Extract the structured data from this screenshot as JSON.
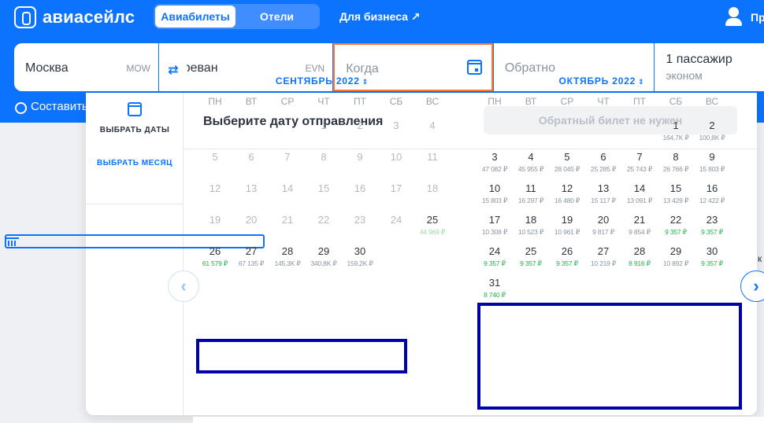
{
  "brand": {
    "name": "авиасейлс"
  },
  "nav": {
    "tab_flights": "Авиабилеты",
    "tab_hotels": "Отели",
    "business": "Для бизнеса ↗",
    "profile": "Пр"
  },
  "search": {
    "from_city": "Москва",
    "from_code": "MOW",
    "to_city": "Ереван",
    "to_code": "EVN",
    "swap_label": "⇄",
    "when_placeholder": "Когда",
    "return_placeholder": "Обратно",
    "passengers": "1 пассажир",
    "class": "эконом"
  },
  "compose_route": "Составить",
  "calendar": {
    "side_select_dates": "ВЫБРАТЬ ДАТЫ",
    "side_select_month": "ВЫБРАТЬ МЕСЯЦ",
    "title": "Выберите дату отправления",
    "no_return": "Обратный билет не нужен",
    "weekdays": [
      "ПН",
      "ВТ",
      "СР",
      "ЧТ",
      "ПТ",
      "СБ",
      "ВС"
    ],
    "months": [
      {
        "title": "СЕНТЯБРЬ 2022",
        "title_arrow": "⇕",
        "offset": 3,
        "days": [
          {
            "d": "1",
            "p": "",
            "s": "off"
          },
          {
            "d": "2",
            "p": "",
            "s": "off"
          },
          {
            "d": "3",
            "p": "",
            "s": "off"
          },
          {
            "d": "4",
            "p": "",
            "s": "off"
          },
          {
            "d": "5",
            "p": "",
            "s": "off"
          },
          {
            "d": "6",
            "p": "",
            "s": "off"
          },
          {
            "d": "7",
            "p": "",
            "s": "off"
          },
          {
            "d": "8",
            "p": "",
            "s": "off"
          },
          {
            "d": "9",
            "p": "",
            "s": "off"
          },
          {
            "d": "10",
            "p": "",
            "s": "off"
          },
          {
            "d": "11",
            "p": "",
            "s": "off"
          },
          {
            "d": "12",
            "p": "",
            "s": "off"
          },
          {
            "d": "13",
            "p": "",
            "s": "off"
          },
          {
            "d": "14",
            "p": "",
            "s": "off"
          },
          {
            "d": "15",
            "p": "",
            "s": "off"
          },
          {
            "d": "16",
            "p": "",
            "s": "off"
          },
          {
            "d": "17",
            "p": "",
            "s": "off"
          },
          {
            "d": "18",
            "p": "",
            "s": "off"
          },
          {
            "d": "19",
            "p": "",
            "s": "off"
          },
          {
            "d": "20",
            "p": "",
            "s": "off"
          },
          {
            "d": "21",
            "p": "",
            "s": "off"
          },
          {
            "d": "22",
            "p": "",
            "s": "off"
          },
          {
            "d": "23",
            "p": "",
            "s": "off"
          },
          {
            "d": "24",
            "p": "",
            "s": "off"
          },
          {
            "d": "25",
            "p": "44 969 ₽",
            "s": "lightcheap"
          },
          {
            "d": "26",
            "p": "61 579 ₽",
            "s": "cheap"
          },
          {
            "d": "27",
            "p": "67 135 ₽",
            "s": "on"
          },
          {
            "d": "28",
            "p": "145,3K ₽",
            "s": "on"
          },
          {
            "d": "29",
            "p": "340,8K ₽",
            "s": "on"
          },
          {
            "d": "30",
            "p": "159,2K ₽",
            "s": "on"
          }
        ]
      },
      {
        "title": "ОКТЯБРЬ 2022",
        "title_arrow": "⇕",
        "offset": 5,
        "days": [
          {
            "d": "1",
            "p": "164,7K ₽",
            "s": "on"
          },
          {
            "d": "2",
            "p": "100,8K ₽",
            "s": "on"
          },
          {
            "d": "3",
            "p": "47 082 ₽",
            "s": "on"
          },
          {
            "d": "4",
            "p": "45 955 ₽",
            "s": "on"
          },
          {
            "d": "5",
            "p": "28 045 ₽",
            "s": "on"
          },
          {
            "d": "6",
            "p": "25 285 ₽",
            "s": "on"
          },
          {
            "d": "7",
            "p": "25 743 ₽",
            "s": "on"
          },
          {
            "d": "8",
            "p": "26 766 ₽",
            "s": "on"
          },
          {
            "d": "9",
            "p": "15 803 ₽",
            "s": "on"
          },
          {
            "d": "10",
            "p": "15 803 ₽",
            "s": "on"
          },
          {
            "d": "11",
            "p": "16 297 ₽",
            "s": "on"
          },
          {
            "d": "12",
            "p": "16 480 ₽",
            "s": "on"
          },
          {
            "d": "13",
            "p": "15 117 ₽",
            "s": "on"
          },
          {
            "d": "14",
            "p": "13 091 ₽",
            "s": "on"
          },
          {
            "d": "15",
            "p": "13 429 ₽",
            "s": "on"
          },
          {
            "d": "16",
            "p": "12 422 ₽",
            "s": "on"
          },
          {
            "d": "17",
            "p": "10 308 ₽",
            "s": "on"
          },
          {
            "d": "18",
            "p": "10 523 ₽",
            "s": "on"
          },
          {
            "d": "19",
            "p": "10 961 ₽",
            "s": "on"
          },
          {
            "d": "20",
            "p": "9 817 ₽",
            "s": "on"
          },
          {
            "d": "21",
            "p": "9 854 ₽",
            "s": "on"
          },
          {
            "d": "22",
            "p": "9 357 ₽",
            "s": "cheap"
          },
          {
            "d": "23",
            "p": "9 357 ₽",
            "s": "cheap"
          },
          {
            "d": "24",
            "p": "9 357 ₽",
            "s": "cheap"
          },
          {
            "d": "25",
            "p": "9 357 ₽",
            "s": "cheap"
          },
          {
            "d": "26",
            "p": "9 357 ₽",
            "s": "cheap"
          },
          {
            "d": "27",
            "p": "10 219 ₽",
            "s": "on"
          },
          {
            "d": "28",
            "p": "8 916 ₽",
            "s": "cheap"
          },
          {
            "d": "29",
            "p": "10 892 ₽",
            "s": "on"
          },
          {
            "d": "30",
            "p": "9 357 ₽",
            "s": "cheap"
          },
          {
            "d": "31",
            "p": "8 740 ₽",
            "s": "cheap"
          }
        ]
      }
    ],
    "prev_arrow": "‹",
    "next_arrow": "›",
    "edge_text": "к"
  },
  "colors": {
    "brand_blue": "#0c73fe",
    "focus_orange": "#ff7a30",
    "cheap_green": "#1fb24a",
    "highlight_navy": "#0000a8"
  }
}
